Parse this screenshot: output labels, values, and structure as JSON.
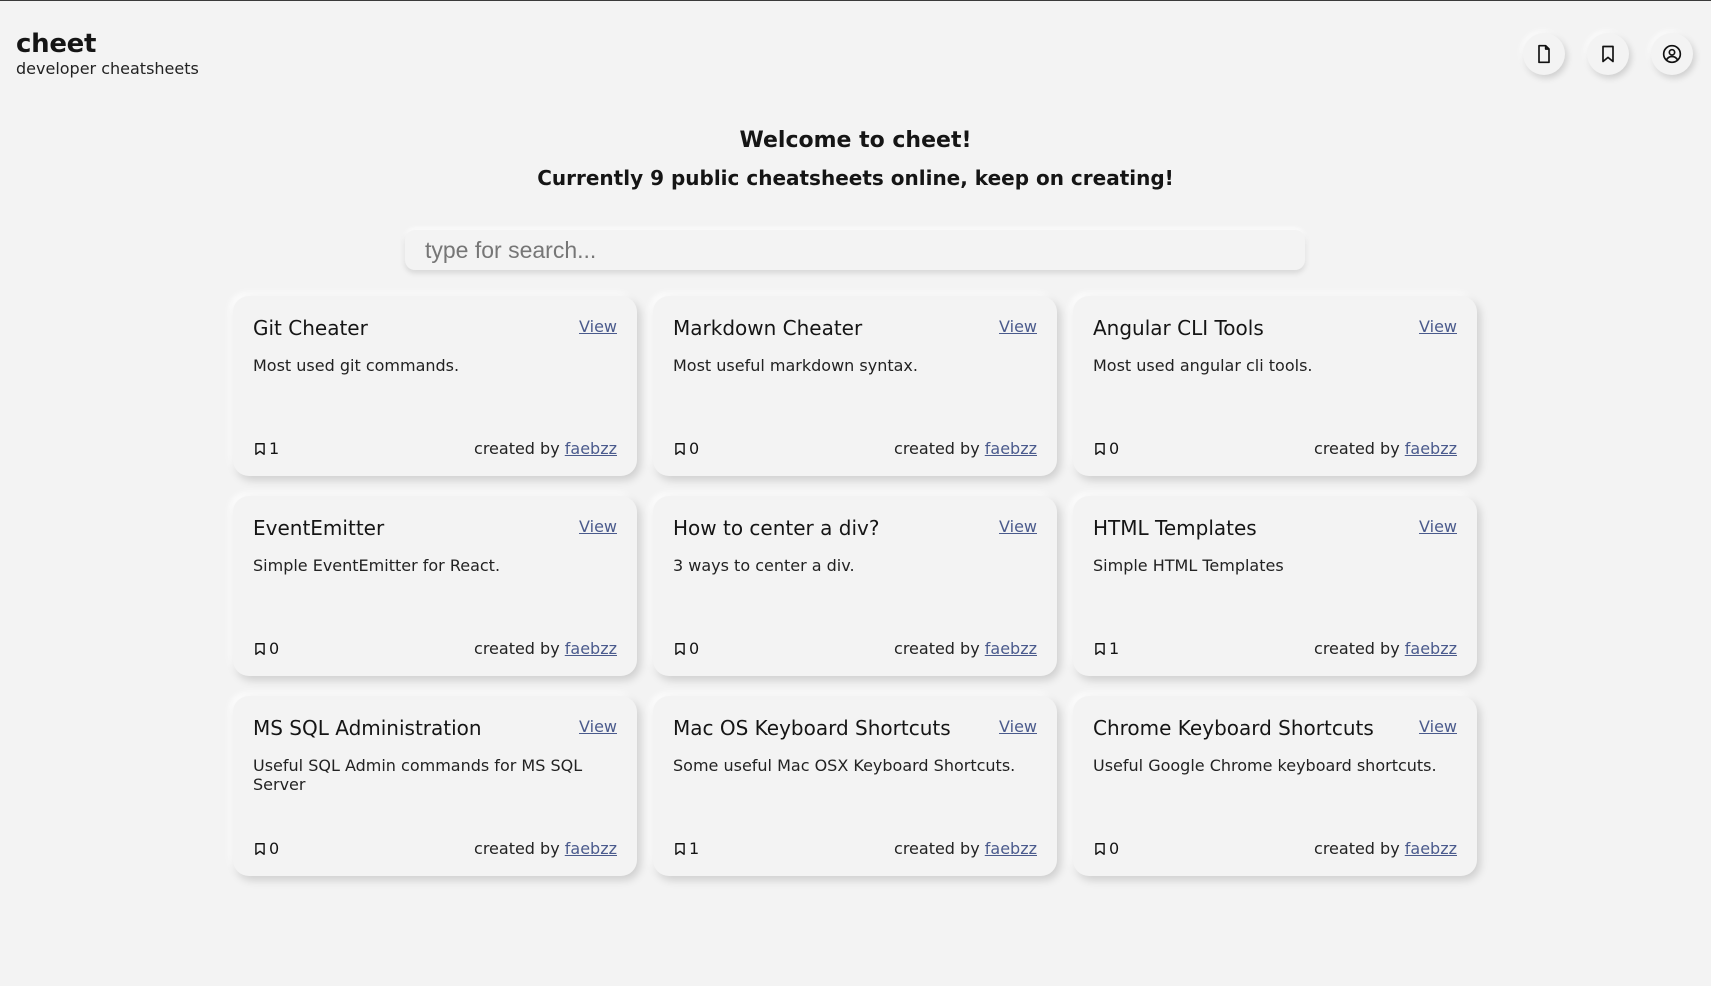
{
  "header": {
    "title": "cheet",
    "subtitle": "developer cheatsheets",
    "nav": [
      {
        "icon": "file-icon",
        "label": "new cheatsheet"
      },
      {
        "icon": "bookmark-icon",
        "label": "bookmarks"
      },
      {
        "icon": "user-circle-icon",
        "label": "profile"
      }
    ]
  },
  "welcome": {
    "title": "Welcome to cheet!",
    "subtitle": "Currently 9 public cheatsheets online, keep on creating!"
  },
  "search": {
    "placeholder": "type for search..."
  },
  "labels": {
    "view": "View",
    "created_by": "created by"
  },
  "cards": [
    {
      "title": "Git Cheater",
      "description": "Most used git commands.",
      "bookmarks": "1",
      "author": "faebzz"
    },
    {
      "title": "Markdown Cheater",
      "description": "Most useful markdown syntax.",
      "bookmarks": "0",
      "author": "faebzz"
    },
    {
      "title": "Angular CLI Tools",
      "description": "Most used angular cli tools.",
      "bookmarks": "0",
      "author": "faebzz"
    },
    {
      "title": "EventEmitter",
      "description": "Simple EventEmitter for React.",
      "bookmarks": "0",
      "author": "faebzz"
    },
    {
      "title": "How to center a div?",
      "description": "3 ways to center a div.",
      "bookmarks": "0",
      "author": "faebzz"
    },
    {
      "title": "HTML Templates",
      "description": "Simple HTML Templates",
      "bookmarks": "1",
      "author": "faebzz"
    },
    {
      "title": "MS SQL Administration",
      "description": "Useful SQL Admin commands for MS SQL Server",
      "bookmarks": "0",
      "author": "faebzz"
    },
    {
      "title": "Mac OS Keyboard Shortcuts",
      "description": "Some useful Mac OSX Keyboard Shortcuts.",
      "bookmarks": "1",
      "author": "faebzz"
    },
    {
      "title": "Chrome Keyboard Shortcuts",
      "description": "Useful Google Chrome keyboard shortcuts.",
      "bookmarks": "0",
      "author": "faebzz"
    }
  ],
  "colors": {
    "background": "#f3f3f3",
    "link": "#4a5a8c",
    "text": "#151515"
  }
}
